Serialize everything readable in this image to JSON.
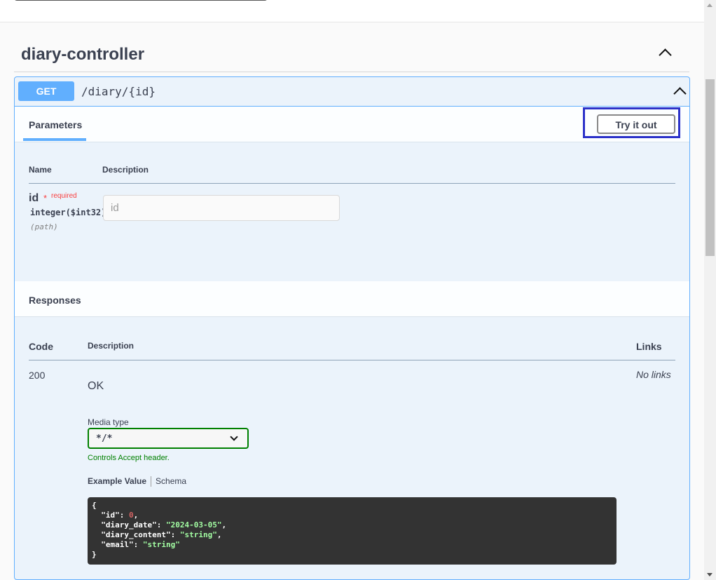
{
  "tag": {
    "title": "diary-controller"
  },
  "operation": {
    "method": "GET",
    "path": "/diary/{id}"
  },
  "parameters": {
    "tab_label": "Parameters",
    "try_button_label": "Try it out",
    "col_name": "Name",
    "col_description": "Description",
    "items": [
      {
        "name": "id",
        "required_star": "*",
        "required_text": "required",
        "type": "integer($int32)",
        "in": "(path)",
        "placeholder": "id"
      }
    ]
  },
  "responses": {
    "title": "Responses",
    "col_code": "Code",
    "col_description": "Description",
    "col_links": "Links",
    "items": [
      {
        "code": "200",
        "description": "OK",
        "links": "No links",
        "media_type_label": "Media type",
        "media_type_value": "*/*",
        "media_type_hint": "Controls Accept header.",
        "example_tab": "Example Value",
        "schema_tab": "Schema",
        "example": {
          "open": "{",
          "close": "}",
          "fields": [
            {
              "key": "\"id\"",
              "value": "0",
              "kind": "num",
              "trail": ","
            },
            {
              "key": "\"diary_date\"",
              "value": "\"2024-03-05\"",
              "kind": "str",
              "trail": ","
            },
            {
              "key": "\"diary_content\"",
              "value": "\"string\"",
              "kind": "str",
              "trail": ","
            },
            {
              "key": "\"email\"",
              "value": "\"string\"",
              "kind": "str",
              "trail": ""
            }
          ]
        }
      }
    ]
  },
  "colors": {
    "get_accent": "#61affe",
    "highlight_border": "#2b31c9",
    "required": "#f93e3e",
    "media_valid": "#008000",
    "code_bg": "#333333"
  },
  "icons": [
    "chevron-up-icon",
    "chevron-down-icon"
  ]
}
